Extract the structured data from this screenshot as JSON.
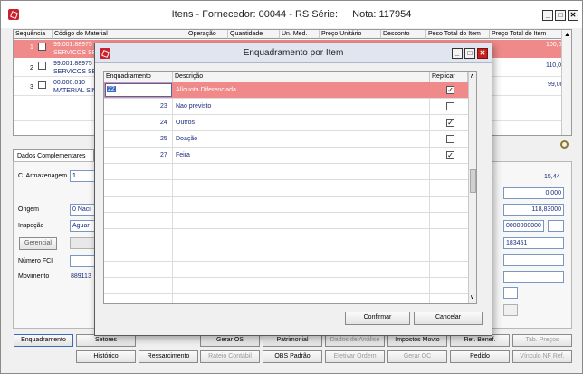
{
  "window": {
    "title": "Itens - Fornecedor: 00044 - RS Série:",
    "nota": "Nota: 117954",
    "controls": [
      "_",
      "□",
      "✕"
    ]
  },
  "main_grid": {
    "headers": [
      "Sequência",
      "Código do Material",
      "Operação",
      "Quantidade",
      "Un. Med.",
      "Preço Unitário",
      "Desconto",
      "Peso Total do Item",
      "Preço Total do Item"
    ],
    "rows": [
      {
        "seq": "1",
        "code": "99.001.88975",
        "desc": "SERVICOS SE",
        "total": "100,00",
        "highlight": true
      },
      {
        "seq": "2",
        "code": "99.001.88975",
        "desc": "SERVICOS SE",
        "total": "110,00",
        "highlight": false
      },
      {
        "seq": "3",
        "code": "00.000.010",
        "desc": "MATERIAL SIN",
        "total": "99,00",
        "highlight": false
      }
    ]
  },
  "complementares": {
    "tab_label": "Dados Complementares",
    "armazenagem_label": "C. Armazenagem",
    "armazenagem_value": "1",
    "origem_label": "Origem",
    "origem_value": "0 Naci",
    "inspecao_label": "Inspeção",
    "inspecao_value": "Aguar",
    "gerencial_label": "Gerencial",
    "numero_fci_label": "Número FCI",
    "movimento_label": "Movimento",
    "movimento_value": "889113"
  },
  "right_panel": {
    "value1": "15,44",
    "value2": "0,000",
    "value3": "118,83000",
    "value4": "0000000000",
    "value5": "183451"
  },
  "bottom_buttons_row1": [
    "Enquadramento",
    "Setores",
    "Gerar OS",
    "Patrimonial",
    "Dados de Análise",
    "Impostos Movto",
    "Ret. Benef.",
    "Tab. Preços"
  ],
  "bottom_buttons_row2": [
    "Histórico",
    "Ressarcimento",
    "Rateio Contábil",
    "OBS Padrão",
    "Efetivar Ordem",
    "Gerar OC",
    "Pedido",
    "Vínculo NF Ref."
  ],
  "dialog": {
    "title": "Enquadramento por Item",
    "headers": [
      "Enquadramento",
      "Descrição",
      "Replicar"
    ],
    "rows": [
      {
        "code": "22",
        "desc": "Alíquota Diferenciada",
        "replicar": true,
        "selected": true
      },
      {
        "code": "23",
        "desc": "Nao previsto",
        "replicar": false,
        "selected": false
      },
      {
        "code": "24",
        "desc": "Outros",
        "replicar": true,
        "selected": false
      },
      {
        "code": "25",
        "desc": "Doação",
        "replicar": false,
        "selected": false
      },
      {
        "code": "27",
        "desc": "Feira",
        "replicar": true,
        "selected": false
      }
    ],
    "confirm_label": "Confirmar",
    "cancel_label": "Cancelar"
  },
  "colors": {
    "highlight_row": "#f08a8a",
    "text_blue": "#1a2a7a",
    "close_red": "#c8201c"
  }
}
